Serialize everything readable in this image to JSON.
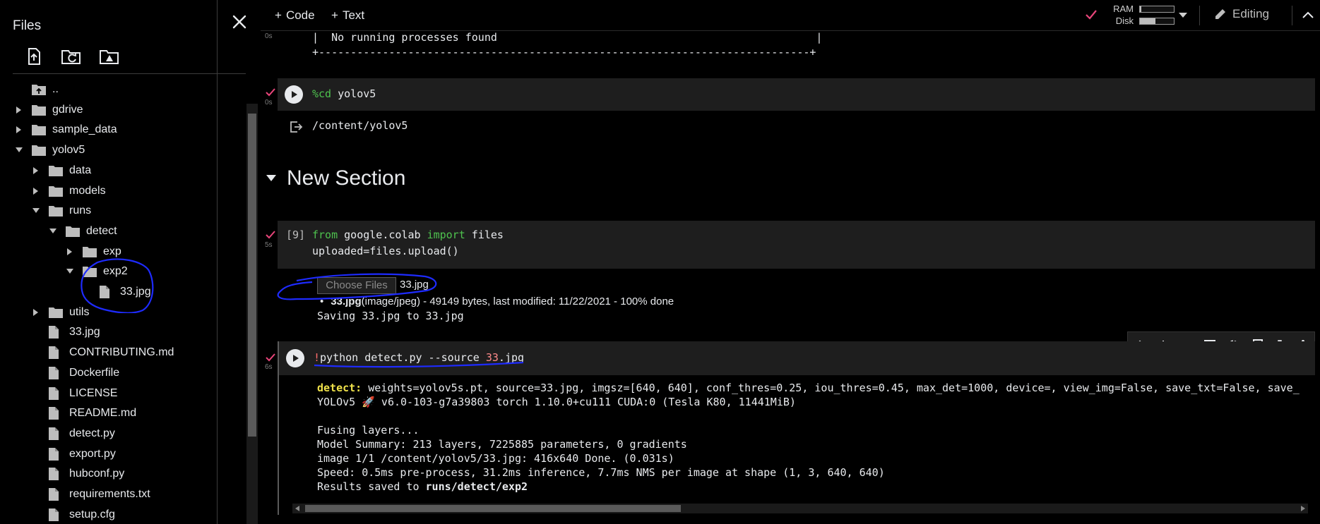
{
  "sidebar": {
    "title": "Files",
    "tree": [
      {
        "label": "..",
        "type": "up",
        "depth": 0
      },
      {
        "label": "gdrive",
        "type": "folder",
        "depth": 0,
        "expanded": false
      },
      {
        "label": "sample_data",
        "type": "folder",
        "depth": 0,
        "expanded": false
      },
      {
        "label": "yolov5",
        "type": "folder",
        "depth": 0,
        "expanded": true
      },
      {
        "label": "data",
        "type": "folder",
        "depth": 1,
        "expanded": false
      },
      {
        "label": "models",
        "type": "folder",
        "depth": 1,
        "expanded": false
      },
      {
        "label": "runs",
        "type": "folder",
        "depth": 1,
        "expanded": true
      },
      {
        "label": "detect",
        "type": "folder",
        "depth": 2,
        "expanded": true
      },
      {
        "label": "exp",
        "type": "folder",
        "depth": 3,
        "expanded": false
      },
      {
        "label": "exp2",
        "type": "folder",
        "depth": 3,
        "expanded": true
      },
      {
        "label": "33.jpg",
        "type": "file",
        "depth": 4
      },
      {
        "label": "utils",
        "type": "folder",
        "depth": 1,
        "expanded": false
      },
      {
        "label": "33.jpg",
        "type": "file",
        "depth": 1
      },
      {
        "label": "CONTRIBUTING.md",
        "type": "file",
        "depth": 1
      },
      {
        "label": "Dockerfile",
        "type": "file",
        "depth": 1
      },
      {
        "label": "LICENSE",
        "type": "file",
        "depth": 1
      },
      {
        "label": "README.md",
        "type": "file",
        "depth": 1
      },
      {
        "label": "detect.py",
        "type": "file",
        "depth": 1
      },
      {
        "label": "export.py",
        "type": "file",
        "depth": 1
      },
      {
        "label": "hubconf.py",
        "type": "file",
        "depth": 1
      },
      {
        "label": "requirements.txt",
        "type": "file",
        "depth": 1
      },
      {
        "label": "setup.cfg",
        "type": "file",
        "depth": 1
      }
    ]
  },
  "toolbar": {
    "add_code": "Code",
    "add_text": "Text",
    "ram_label": "RAM",
    "disk_label": "Disk",
    "ram_level": 0.05,
    "disk_level": 0.45,
    "editing_label": "Editing"
  },
  "cells": {
    "prev_output_timing": "0s",
    "prev_output_line1": "|  No running processes found                                                  |",
    "prev_output_line2": "+-----------------------------------------------------------------------------+",
    "cd_timing": "0s",
    "cd_code_magic": "%cd",
    "cd_code_arg": " yolov5",
    "cd_output": "/content/yolov5",
    "section_title": "New Section",
    "upload_exec_count": "[9]",
    "upload_timing": "5s",
    "upload_line1_kw1": "from",
    "upload_line1_mod": " google.colab ",
    "upload_line1_kw2": "import",
    "upload_line1_rest": " files",
    "upload_line2": "uploaded=files.upload()",
    "choose_files_label": "Choose Files",
    "chosen_file": "33.jpg",
    "upload_file_name": "33.jpg",
    "upload_file_info": "(image/jpeg) - 49149 bytes, last modified: 11/22/2021 - 100% done",
    "upload_saving": "Saving 33.jpg to 33.jpg",
    "detect_timing": "6s",
    "detect_bang": "!",
    "detect_cmd": "python detect.py --source ",
    "detect_num": "33",
    "detect_ext": ".jpg",
    "detect_out_label": "detect:",
    "detect_out_line1": " weights=yolov5s.pt, source=33.jpg, imgsz=[640, 640], conf_thres=0.25, iou_thres=0.45, max_det=1000, device=, view_img=False, save_txt=False, save_",
    "detect_out_line2": "YOLOv5 🚀 v6.0-103-g7a39803 torch 1.10.0+cu111 CUDA:0 (Tesla K80, 11441MiB)",
    "detect_out_line3": "Fusing layers...",
    "detect_out_line4": "Model Summary: 213 layers, 7225885 parameters, 0 gradients",
    "detect_out_line5": "image 1/1 /content/yolov5/33.jpg: 416x640 Done. (0.031s)",
    "detect_out_line6": "Speed: 0.5ms pre-process, 31.2ms inference, 7.7ms NMS per image at shape (1, 3, 640, 640)",
    "detect_out_line7_pre": "Results saved to ",
    "detect_out_line7_path": "runs/detect/exp2"
  },
  "colors": {
    "accent_check": "#e8457a",
    "annotation_blue": "#1e2bff",
    "keyword": "#4ec24e"
  }
}
